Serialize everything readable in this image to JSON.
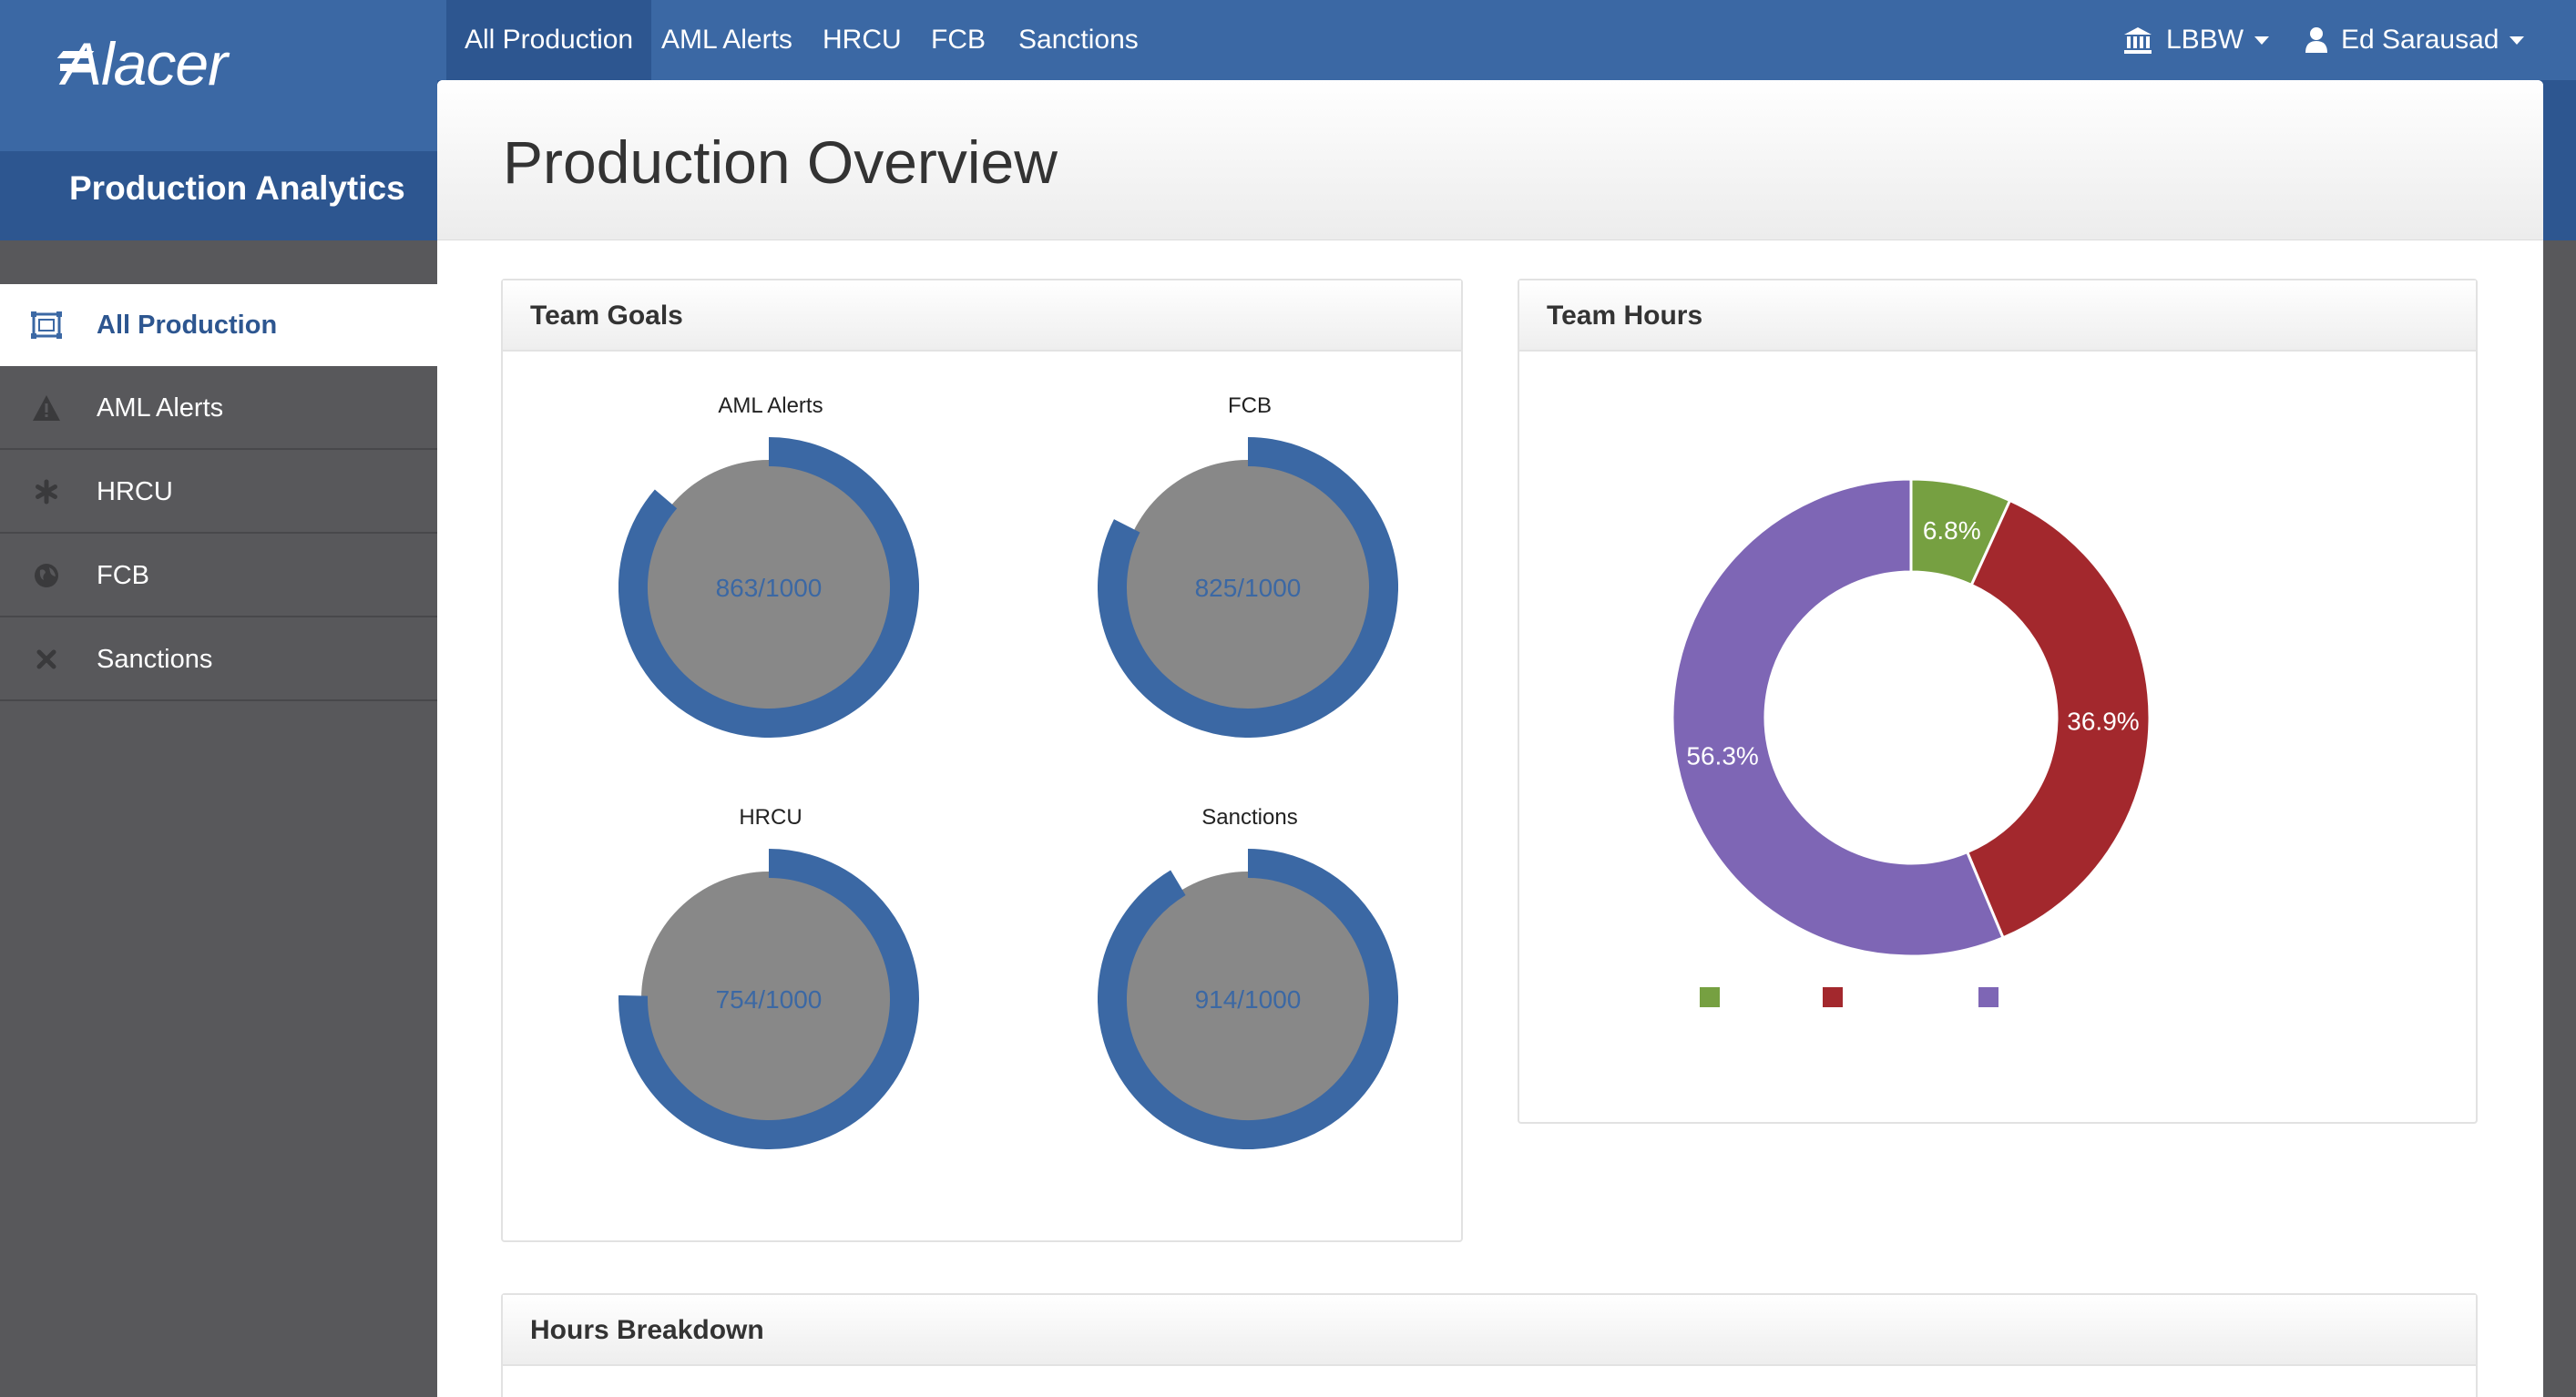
{
  "brand": {
    "logo_text": "Alacer",
    "app_title": "Production Analytics"
  },
  "topnav": {
    "items": [
      {
        "label": "All Production",
        "active": true
      },
      {
        "label": "AML Alerts"
      },
      {
        "label": "HRCU"
      },
      {
        "label": "FCB"
      },
      {
        "label": "Sanctions"
      }
    ],
    "org": {
      "label": "LBBW",
      "icon": "bank-icon"
    },
    "user": {
      "label": "Ed Sarausad",
      "icon": "user-icon"
    }
  },
  "sidebar": {
    "items": [
      {
        "label": "All Production",
        "icon": "dashboard-icon",
        "active": true
      },
      {
        "label": "AML Alerts",
        "icon": "warning-icon"
      },
      {
        "label": "HRCU",
        "icon": "asterisk-icon"
      },
      {
        "label": "FCB",
        "icon": "globe-icon"
      },
      {
        "label": "Sanctions",
        "icon": "close-icon"
      }
    ]
  },
  "page": {
    "title": "Production Overview"
  },
  "team_goals": {
    "title": "Team Goals",
    "gauges": [
      {
        "name": "AML Alerts",
        "text": "863/1000",
        "value": 863,
        "max": 1000
      },
      {
        "name": "FCB",
        "text": "825/1000",
        "value": 825,
        "max": 1000
      },
      {
        "name": "HRCU",
        "text": "754/1000",
        "value": 754,
        "max": 1000
      },
      {
        "name": "Sanctions",
        "text": "914/1000",
        "value": 914,
        "max": 1000
      }
    ]
  },
  "team_hours": {
    "title": "Team Hours",
    "chart_data": {
      "type": "pie",
      "donut": true,
      "slices": [
        {
          "label": "6.8%",
          "value": 6.8,
          "color": "#76a041"
        },
        {
          "label": "36.9%",
          "value": 36.9,
          "color": "#a3282d"
        },
        {
          "label": "56.3%",
          "value": 56.3,
          "color": "#7e66b5"
        }
      ],
      "legend_placement": "bottom"
    }
  },
  "hours_breakdown": {
    "title": "Hours Breakdown"
  },
  "colors": {
    "primary": "#3b68a4",
    "primary_dark": "#2d5690",
    "sidebar": "#58585b",
    "gauge_fill": "#888888"
  }
}
